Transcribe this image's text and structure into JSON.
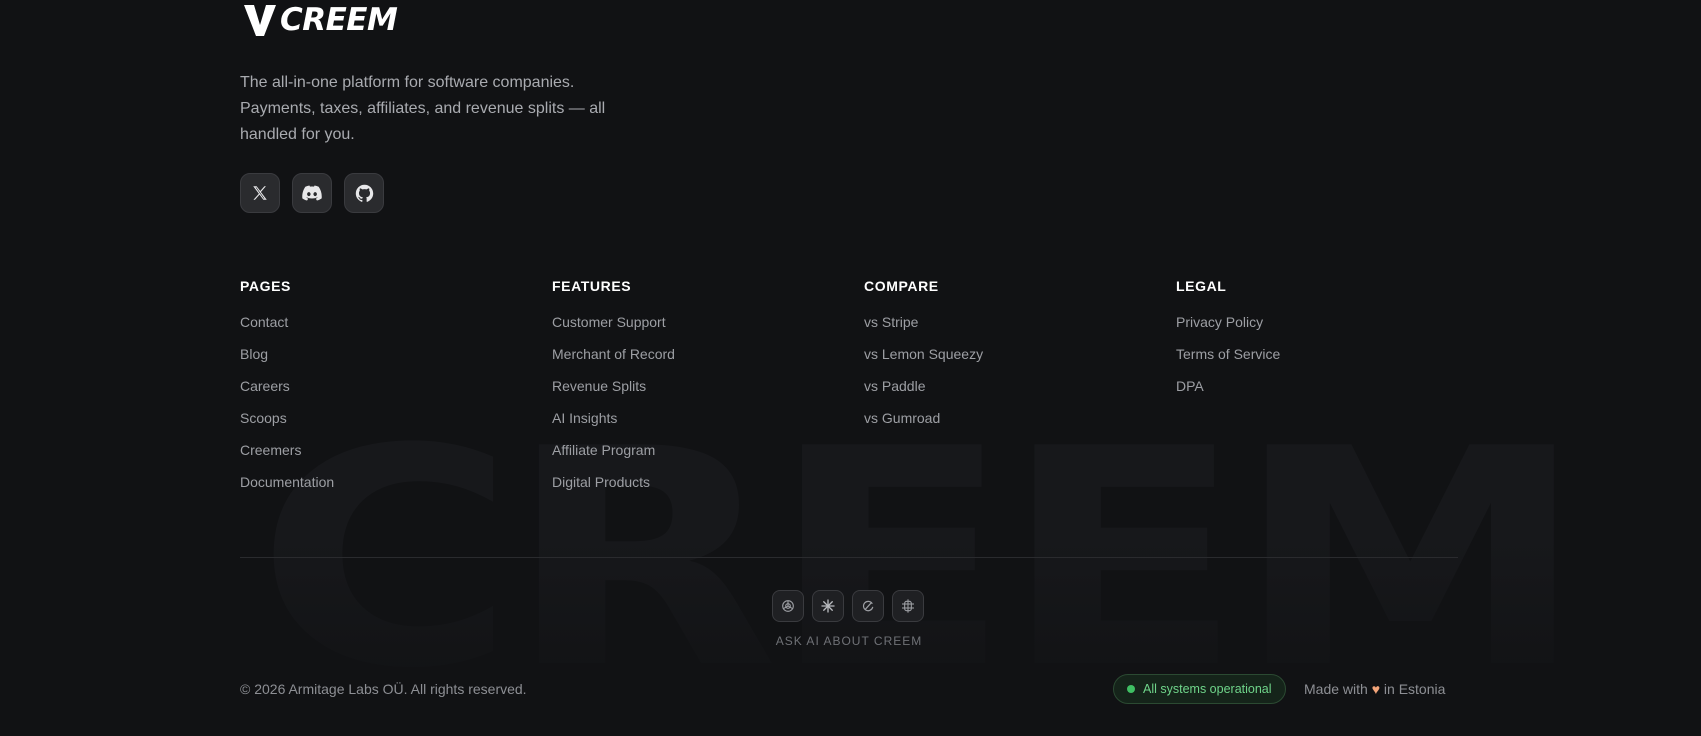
{
  "brand": {
    "name": "CREEM",
    "tagline": "The all-in-one platform for software companies. Payments, taxes, affiliates, and revenue splits — all handled for you.",
    "watermark": "CREEM"
  },
  "socials": [
    {
      "icon": "x-twitter-icon"
    },
    {
      "icon": "discord-icon"
    },
    {
      "icon": "github-icon"
    }
  ],
  "columns": {
    "pages": {
      "title": "PAGES",
      "links": [
        "Contact",
        "Blog",
        "Careers",
        "Scoops",
        "Creemers",
        "Documentation"
      ]
    },
    "features": {
      "title": "FEATURES",
      "links": [
        "Customer Support",
        "Merchant of Record",
        "Revenue Splits",
        "AI Insights",
        "Affiliate Program",
        "Digital Products"
      ]
    },
    "compare": {
      "title": "COMPARE",
      "links": [
        "vs Stripe",
        "vs Lemon Squeezy",
        "vs Paddle",
        "vs Gumroad"
      ]
    },
    "legal": {
      "title": "LEGAL",
      "links": [
        "Privacy Policy",
        "Terms of Service",
        "DPA"
      ]
    }
  },
  "ask_ai": {
    "label": "ASK AI ABOUT CREEM",
    "icons": [
      "chatgpt-icon",
      "claude-icon",
      "perplexity-icon",
      "grok-icon"
    ]
  },
  "bottom": {
    "copyright": "© 2026 Armitage Labs OÜ. All rights reserved.",
    "status": "All systems operational",
    "made_with_prefix": "Made with",
    "heart": "♥",
    "made_with_suffix": "in Estonia"
  },
  "colors": {
    "background": "#111214",
    "status_green": "#6fd48a",
    "heart": "#f4a57a"
  }
}
